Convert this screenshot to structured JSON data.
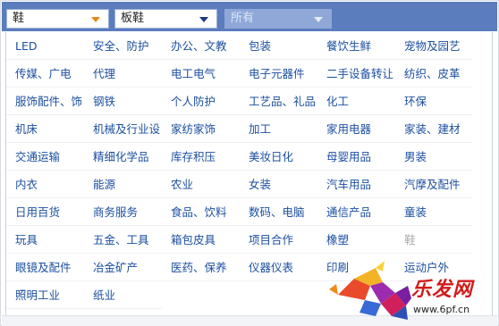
{
  "selects": {
    "first": "鞋",
    "second": "板鞋",
    "third": "所有"
  },
  "categories": [
    "LED",
    "安全、防护",
    "办公、文教",
    "包装",
    "餐饮生鲜",
    "宠物及园艺",
    "传媒、广电",
    "代理",
    "电工电气",
    "电子元器件",
    "二手设备转让",
    "纺织、皮革",
    "服饰配件、饰",
    "钢铁",
    "个人防护",
    "工艺品、礼品",
    "化工",
    "环保",
    "机床",
    "机械及行业设",
    "家纺家饰",
    "加工",
    "家用电器",
    "家装、建材",
    "交通运输",
    "精细化学品",
    "库存积压",
    "美妆日化",
    "母婴用品",
    "男装",
    "内衣",
    "能源",
    "农业",
    "女装",
    "汽车用品",
    "汽摩及配件",
    "日用百货",
    "商务服务",
    "食品、饮料",
    "数码、电脑",
    "通信产品",
    "童装",
    "玩具",
    "五金、工具",
    "箱包皮具",
    "项目合作",
    "橡塑",
    "鞋",
    "眼镜及配件",
    "冶金矿产",
    "医药、保养",
    "仪器仪表",
    "印刷",
    "运动户外",
    "照明工业",
    "纸业"
  ],
  "muted_index": 47,
  "watermark": {
    "brand": "乐发网",
    "url": "www.6pf.cn"
  },
  "colors": {
    "topbar": "#5b7dbe",
    "link": "#1c4fa0",
    "muted": "#a9a9a9",
    "brand_red": "#d21a1a"
  },
  "icons": [
    "dropdown-caret-icon",
    "bull-logo-icon"
  ]
}
